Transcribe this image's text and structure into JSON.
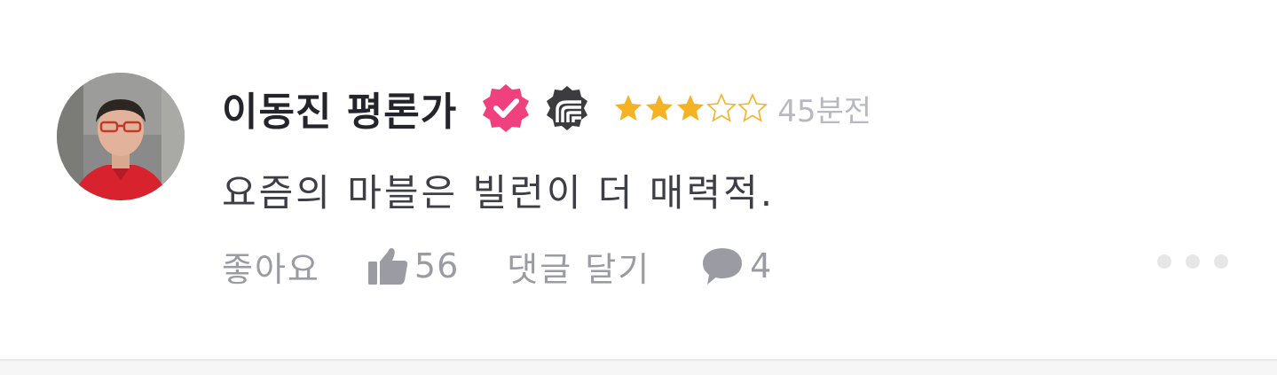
{
  "review": {
    "author": "이동진 평론가",
    "rating": {
      "value": 3,
      "max": 5
    },
    "time": "45분전",
    "comment": "요즘의 마블은 빌런이 더 매력적.",
    "like_label": "좋아요",
    "like_count": "56",
    "reply_label": "댓글 달기",
    "reply_count": "4"
  },
  "icons": {
    "verified": "verified-badge-icon",
    "critic": "critic-badge-icon",
    "like": "thumbs-up-icon",
    "reply": "speech-bubble-icon",
    "more": "more-dots-icon"
  },
  "colors": {
    "star_filled": "#f5b323",
    "verified_badge": "#f0417e",
    "critic_badge": "#3b3b40",
    "text_muted": "#9b9ba4",
    "name": "#24242c"
  }
}
